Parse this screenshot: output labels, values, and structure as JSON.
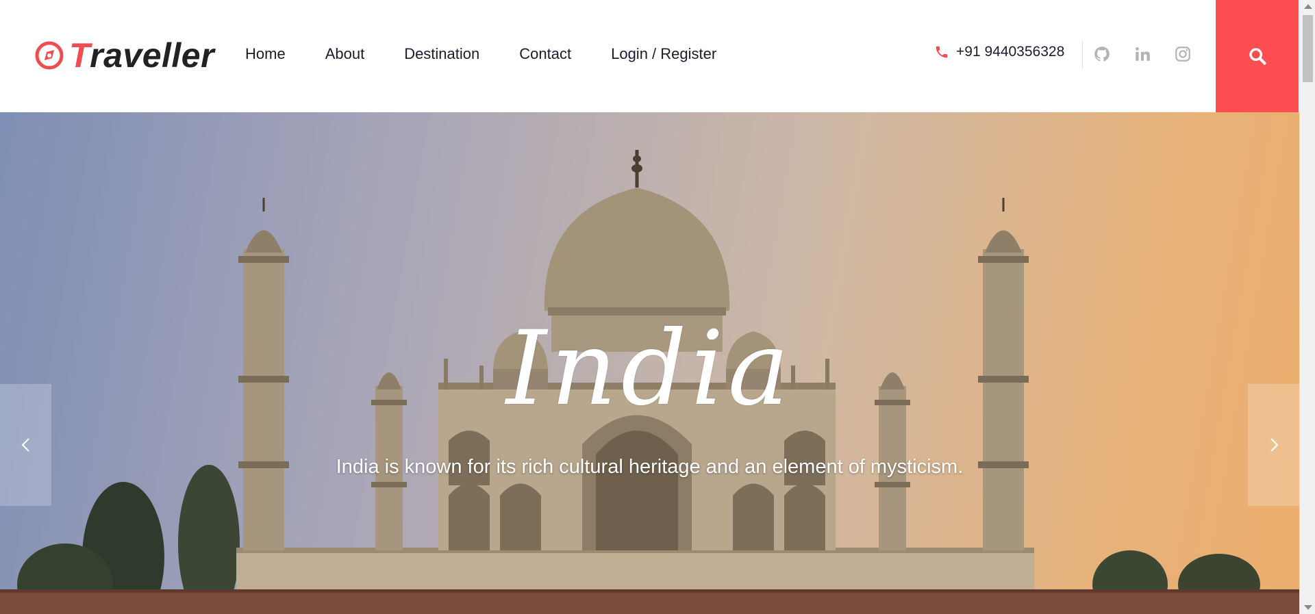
{
  "brand": {
    "name_first": "T",
    "name_rest": "raveller",
    "accent_color": "#ee4d52"
  },
  "nav": {
    "items": [
      {
        "label": "Home"
      },
      {
        "label": "About"
      },
      {
        "label": "Destination"
      },
      {
        "label": "Contact"
      },
      {
        "label": "Login / Register"
      }
    ]
  },
  "contact": {
    "phone": "+91 9440356328",
    "phone_icon": "phone-icon"
  },
  "social": [
    {
      "icon": "github-icon"
    },
    {
      "icon": "linkedin-icon"
    },
    {
      "icon": "instagram-icon"
    }
  ],
  "search": {
    "icon": "search-icon",
    "bg_color": "#ff4e52"
  },
  "hero": {
    "title": "India",
    "subtitle": "India is known for its rich cultural heritage and an element of mysticism.",
    "prev_icon": "chevron-left-icon",
    "next_icon": "chevron-right-icon"
  }
}
